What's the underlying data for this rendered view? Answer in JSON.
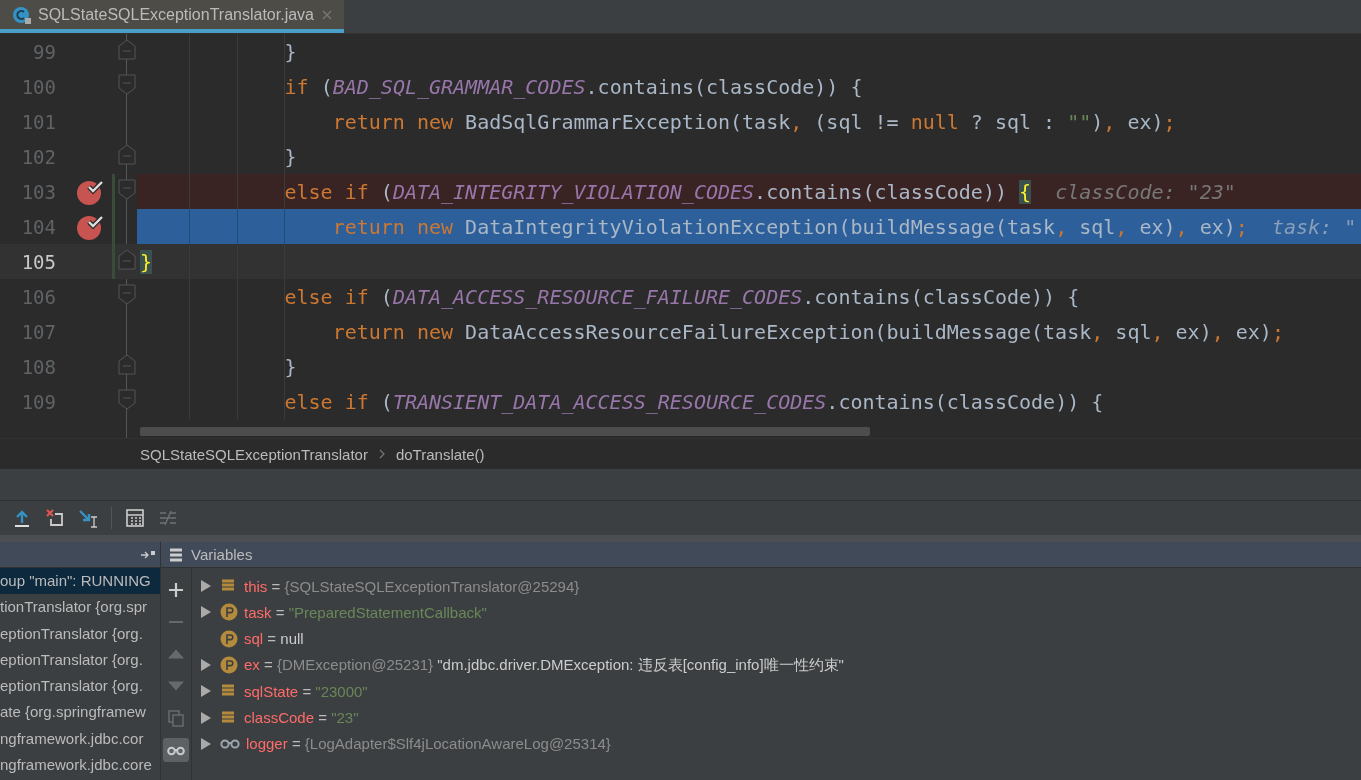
{
  "editor_tab": {
    "title": "SQLStateSQLExceptionTranslator.java",
    "selected": true
  },
  "code_lines": [
    {
      "number": "99",
      "fold_start": false,
      "fold_end": true,
      "breakpoint": false,
      "modified": false,
      "executing": false,
      "caret": false,
      "tokens": [
        {
          "kind": "plain",
          "text": "            }"
        }
      ]
    },
    {
      "number": "100",
      "fold_start": true,
      "fold_end": false,
      "breakpoint": false,
      "modified": false,
      "executing": false,
      "caret": false,
      "tokens": [
        {
          "kind": "kw",
          "text": "            if "
        },
        {
          "kind": "plain",
          "text": "("
        },
        {
          "kind": "const",
          "text": "BAD_SQL_GRAMMAR_CODES"
        },
        {
          "kind": "plain",
          "text": ".contains(classCode)) {"
        }
      ]
    },
    {
      "number": "101",
      "fold_start": false,
      "fold_end": false,
      "breakpoint": false,
      "modified": false,
      "executing": false,
      "caret": false,
      "tokens": [
        {
          "kind": "kw",
          "text": "                return new "
        },
        {
          "kind": "plain",
          "text": "BadSqlGrammarException(task"
        },
        {
          "kind": "kw",
          "text": ", "
        },
        {
          "kind": "plain",
          "text": "(sql != "
        },
        {
          "kind": "kw",
          "text": "null "
        },
        {
          "kind": "plain",
          "text": "? sql : "
        },
        {
          "kind": "str",
          "text": "\"\""
        },
        {
          "kind": "plain",
          "text": ")"
        },
        {
          "kind": "kw",
          "text": ", "
        },
        {
          "kind": "plain",
          "text": "ex)"
        },
        {
          "kind": "kw",
          "text": ";"
        }
      ]
    },
    {
      "number": "102",
      "fold_start": false,
      "fold_end": true,
      "breakpoint": false,
      "modified": false,
      "executing": false,
      "caret": false,
      "tokens": [
        {
          "kind": "plain",
          "text": "            }"
        }
      ]
    },
    {
      "number": "103",
      "fold_start": true,
      "fold_end": false,
      "breakpoint": true,
      "modified": true,
      "executing": false,
      "caret": false,
      "tokens": [
        {
          "kind": "kw",
          "text": "            else if "
        },
        {
          "kind": "plain",
          "text": "("
        },
        {
          "kind": "const",
          "text": "DATA_INTEGRITY_VIOLATION_CODES"
        },
        {
          "kind": "plain",
          "text": ".contains(classCode)) "
        },
        {
          "kind": "match",
          "text": "{"
        },
        {
          "kind": "hint",
          "text": "  classCode: \"23\""
        }
      ]
    },
    {
      "number": "104",
      "fold_start": false,
      "fold_end": false,
      "breakpoint": true,
      "modified": true,
      "executing": true,
      "caret": false,
      "tokens": [
        {
          "kind": "kw",
          "text": "                return new "
        },
        {
          "kind": "plain",
          "text": "DataIntegrityViolationException(buildMessage(task"
        },
        {
          "kind": "kw",
          "text": ", "
        },
        {
          "kind": "plain",
          "text": "sql"
        },
        {
          "kind": "kw",
          "text": ", "
        },
        {
          "kind": "plain",
          "text": "ex)"
        },
        {
          "kind": "kw",
          "text": ", "
        },
        {
          "kind": "plain",
          "text": "ex)"
        },
        {
          "kind": "kw",
          "text": ";"
        },
        {
          "kind": "hint",
          "text": "  task: \""
        }
      ]
    },
    {
      "number": "105",
      "fold_start": false,
      "fold_end": true,
      "breakpoint": false,
      "modified": true,
      "executing": false,
      "caret": true,
      "tokens": [
        {
          "kind": "match",
          "text": "            }"
        }
      ]
    },
    {
      "number": "106",
      "fold_start": true,
      "fold_end": false,
      "breakpoint": false,
      "modified": false,
      "executing": false,
      "caret": false,
      "tokens": [
        {
          "kind": "kw",
          "text": "            else if "
        },
        {
          "kind": "plain",
          "text": "("
        },
        {
          "kind": "const",
          "text": "DATA_ACCESS_RESOURCE_FAILURE_CODES"
        },
        {
          "kind": "plain",
          "text": ".contains(classCode)) {"
        }
      ]
    },
    {
      "number": "107",
      "fold_start": false,
      "fold_end": false,
      "breakpoint": false,
      "modified": false,
      "executing": false,
      "caret": false,
      "tokens": [
        {
          "kind": "kw",
          "text": "                return new "
        },
        {
          "kind": "plain",
          "text": "DataAccessResourceFailureException(buildMessage(task"
        },
        {
          "kind": "kw",
          "text": ", "
        },
        {
          "kind": "plain",
          "text": "sql"
        },
        {
          "kind": "kw",
          "text": ", "
        },
        {
          "kind": "plain",
          "text": "ex)"
        },
        {
          "kind": "kw",
          "text": ", "
        },
        {
          "kind": "plain",
          "text": "ex)"
        },
        {
          "kind": "kw",
          "text": ";"
        }
      ]
    },
    {
      "number": "108",
      "fold_start": false,
      "fold_end": true,
      "breakpoint": false,
      "modified": false,
      "executing": false,
      "caret": false,
      "tokens": [
        {
          "kind": "plain",
          "text": "            }"
        }
      ]
    },
    {
      "number": "109",
      "fold_start": true,
      "fold_end": false,
      "breakpoint": false,
      "modified": false,
      "executing": false,
      "caret": false,
      "tokens": [
        {
          "kind": "kw",
          "text": "            else if "
        },
        {
          "kind": "plain",
          "text": "("
        },
        {
          "kind": "const",
          "text": "TRANSIENT_DATA_ACCESS_RESOURCE_CODES"
        },
        {
          "kind": "plain",
          "text": ".contains(classCode)) {"
        }
      ]
    }
  ],
  "breadcrumbs": [
    "SQLStateSQLExceptionTranslator",
    "doTranslate()"
  ],
  "debug_toolbar": [
    {
      "kind": "step-out",
      "disabled": false
    },
    {
      "kind": "drop-frame",
      "disabled": false
    },
    {
      "kind": "run-to-cursor",
      "disabled": false
    },
    {
      "kind": "evaluate",
      "disabled": false
    },
    {
      "kind": "trace",
      "disabled": true
    }
  ],
  "frames": {
    "items": [
      {
        "text": "oup \"main\": RUNNING",
        "selected": true
      },
      {
        "text": "tionTranslator {org.spr",
        "selected": false
      },
      {
        "text": "eptionTranslator {org.",
        "selected": false
      },
      {
        "text": "eptionTranslator {org.",
        "selected": false
      },
      {
        "text": "eptionTranslator {org.",
        "selected": false
      },
      {
        "text": "ate {org.springframew",
        "selected": false
      },
      {
        "text": "ngframework.jdbc.cor",
        "selected": false
      },
      {
        "text": "ngframework.jdbc.core",
        "selected": false
      }
    ]
  },
  "variables": {
    "title": "Variables",
    "side_buttons": [
      {
        "kind": "add",
        "disabled": false,
        "selected": false
      },
      {
        "kind": "remove",
        "disabled": true,
        "selected": false
      },
      {
        "kind": "up",
        "disabled": true,
        "selected": false
      },
      {
        "kind": "down",
        "disabled": true,
        "selected": false
      },
      {
        "kind": "copy",
        "disabled": true,
        "selected": false
      },
      {
        "kind": "watches",
        "disabled": false,
        "selected": true
      }
    ],
    "items": [
      {
        "kind": "field",
        "expandable": true,
        "name": "this",
        "separator": "=",
        "ref": "{SQLStateSQLExceptionTranslator@25294}"
      },
      {
        "kind": "param",
        "expandable": true,
        "name": "task",
        "separator": "=",
        "string": "\"PreparedStatementCallback\""
      },
      {
        "kind": "param",
        "expandable": false,
        "name": "sql",
        "separator": "=",
        "plain": "null"
      },
      {
        "kind": "param",
        "expandable": true,
        "name": "ex",
        "separator": "=",
        "ref": "{DMException@25231}",
        "plain": "\"dm.jdbc.driver.DMException: 违反表[config_info]唯一性约束\""
      },
      {
        "kind": "field",
        "expandable": true,
        "name": "sqlState",
        "separator": "=",
        "string": "\"23000\""
      },
      {
        "kind": "field",
        "expandable": true,
        "name": "classCode",
        "separator": "=",
        "string": "\"23\""
      },
      {
        "kind": "watch",
        "expandable": true,
        "name": "logger",
        "separator": "=",
        "ref": "{LogAdapter$Slf4jLocationAwareLog@25314}"
      }
    ]
  }
}
